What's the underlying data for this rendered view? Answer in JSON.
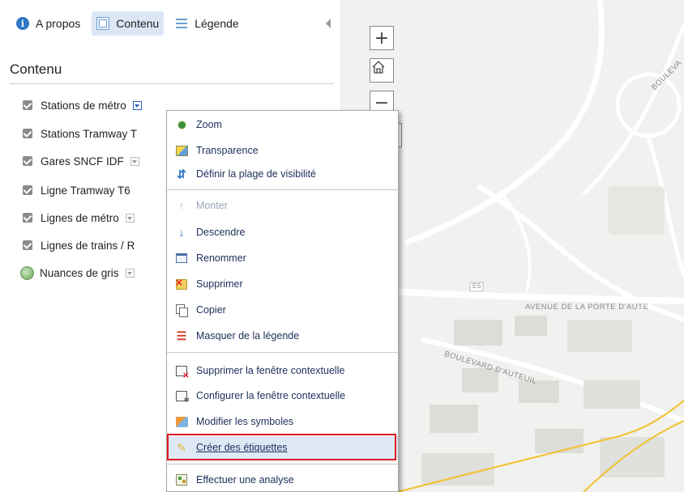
{
  "tabs": [
    {
      "label": "A propos",
      "icon": "info-icon"
    },
    {
      "label": "Contenu",
      "icon": "content-icon",
      "active": true
    },
    {
      "label": "Légende",
      "icon": "legend-icon"
    }
  ],
  "panel": {
    "title": "Contenu",
    "layers": [
      {
        "label": "Stations de métro",
        "checked": true
      },
      {
        "label": "Stations Tramway T",
        "checked": true
      },
      {
        "label": "Gares SNCF IDF",
        "checked": true
      },
      {
        "label": "Ligne Tramway T6",
        "checked": true
      },
      {
        "label": "Lignes de métro",
        "checked": true
      },
      {
        "label": "Lignes de trains / R",
        "checked": true
      },
      {
        "label": "Nuances de gris",
        "basemap": true
      }
    ]
  },
  "map": {
    "zoom_in": "+",
    "zoom_out": "−",
    "labels": [
      "BOULEVA",
      "E5",
      "AVENUE DE LA PORTE D'AUTE",
      "BOULEVARD D'AUTEUIL"
    ]
  },
  "menu": {
    "items": [
      {
        "label": "Zoom",
        "icon": "zoom-icon"
      },
      {
        "label": "Transparence",
        "icon": "transparency-icon"
      },
      {
        "label": "Définir la plage de visibilité",
        "icon": "visibility-range-icon"
      },
      {
        "label": "Monter",
        "icon": "arrow-up-icon",
        "disabled": true
      },
      {
        "label": "Descendre",
        "icon": "arrow-down-icon"
      },
      {
        "label": "Renommer",
        "icon": "rename-icon"
      },
      {
        "label": "Supprimer",
        "icon": "delete-icon"
      },
      {
        "label": "Copier",
        "icon": "copy-icon"
      },
      {
        "label": "Masquer de la légende",
        "icon": "hide-legend-icon"
      },
      {
        "label": "Supprimer la fenêtre contextuelle",
        "icon": "delete-popup-icon"
      },
      {
        "label": "Configurer la fenêtre contextuelle",
        "icon": "configure-popup-icon"
      },
      {
        "label": "Modifier les symboles",
        "icon": "symbols-icon"
      },
      {
        "label": "Créer des étiquettes",
        "icon": "labels-icon",
        "highlighted": true
      },
      {
        "label": "Effectuer une analyse",
        "icon": "analysis-icon"
      }
    ]
  },
  "colors": {
    "highlight_border": "#e01a22",
    "tram_line": "#f2c12e",
    "menu_text": "#1c2d5a"
  }
}
